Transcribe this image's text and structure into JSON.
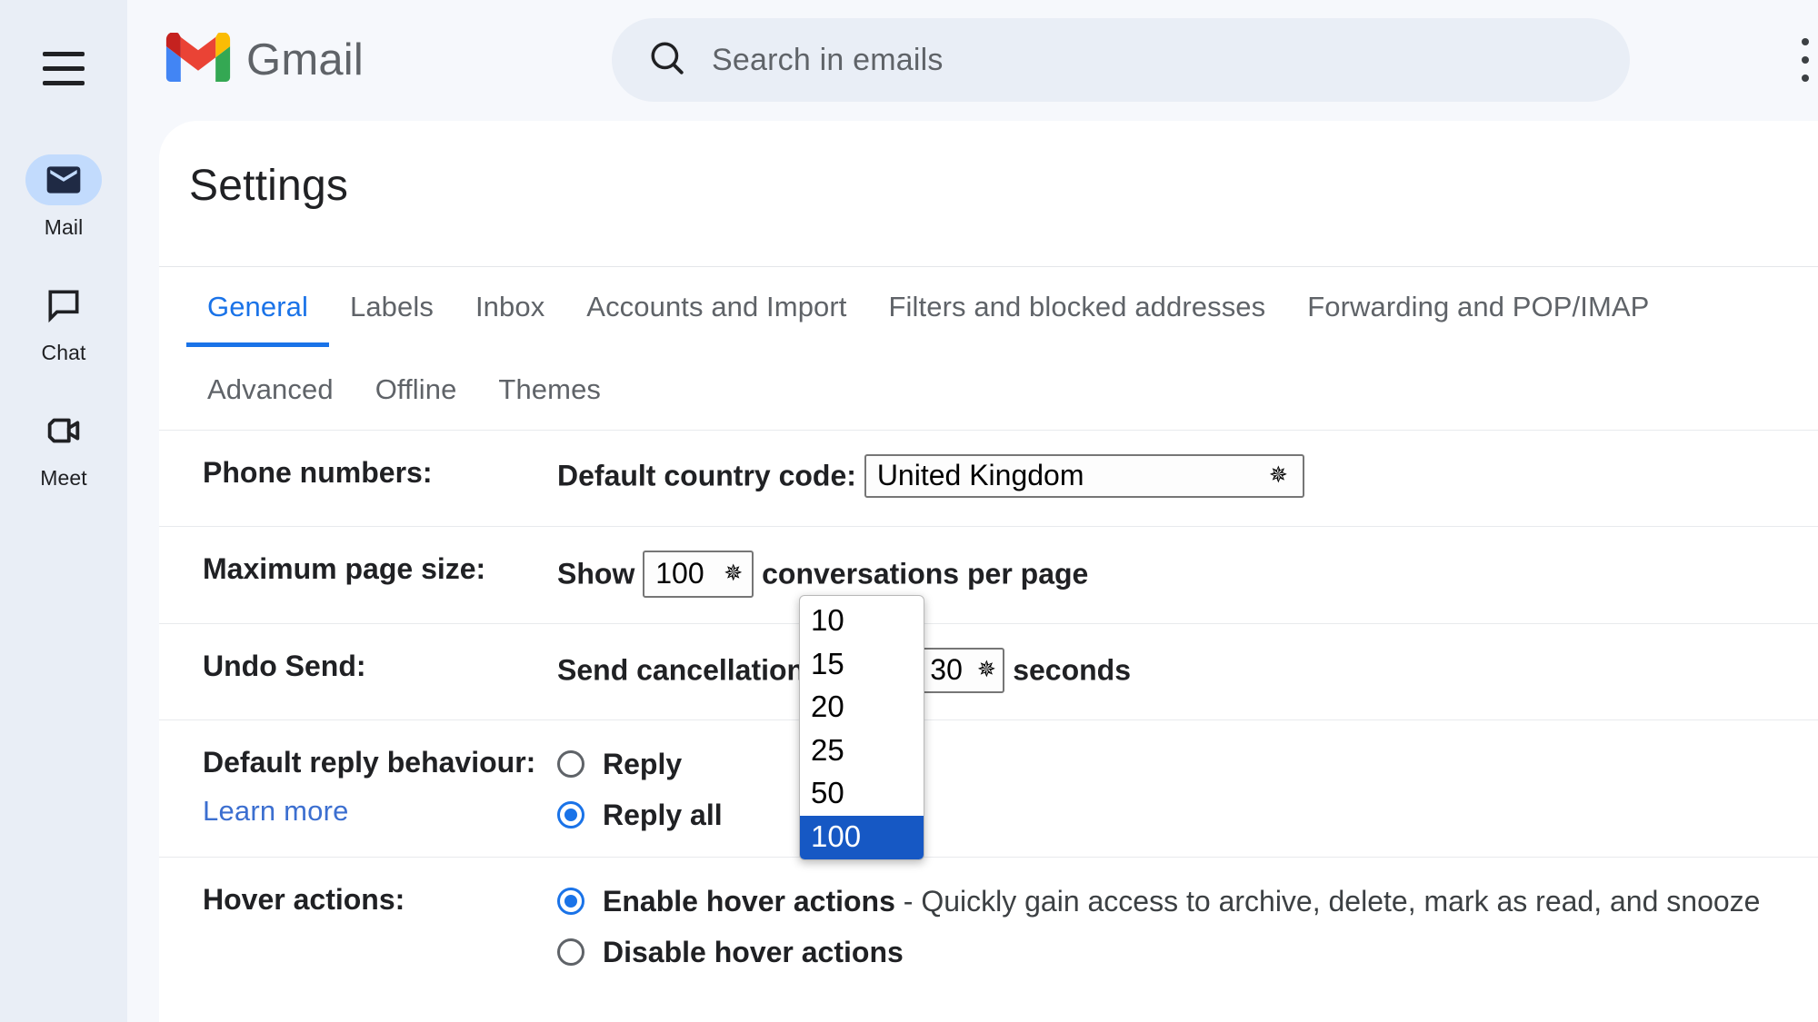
{
  "app": {
    "brand_name": "Gmail",
    "menu_icon": "hamburger-menu-icon",
    "kebab_icon": "more-options-icon"
  },
  "search": {
    "placeholder": "Search in emails",
    "icon": "search-icon"
  },
  "rail": {
    "items": [
      {
        "label": "Mail",
        "icon": "mail-icon",
        "active": true
      },
      {
        "label": "Chat",
        "icon": "chat-bubble-icon",
        "active": false
      },
      {
        "label": "Meet",
        "icon": "video-camera-icon",
        "active": false
      }
    ]
  },
  "page": {
    "title": "Settings"
  },
  "tabs": {
    "row1": [
      {
        "label": "General",
        "active": true
      },
      {
        "label": "Labels",
        "active": false
      },
      {
        "label": "Inbox",
        "active": false
      },
      {
        "label": "Accounts and Import",
        "active": false
      },
      {
        "label": "Filters and blocked addresses",
        "active": false
      },
      {
        "label": "Forwarding and POP/IMAP",
        "active": false
      }
    ],
    "row2": [
      {
        "label": "Advanced",
        "active": false
      },
      {
        "label": "Offline",
        "active": false
      },
      {
        "label": "Themes",
        "active": false
      }
    ]
  },
  "settings": {
    "phone_numbers": {
      "label": "Phone numbers:",
      "prefix": "Default country code:",
      "country_value": "United Kingdom"
    },
    "max_page_size": {
      "label": "Maximum page size:",
      "prefix": "Show",
      "value": "100",
      "suffix": "conversations per page"
    },
    "undo_send": {
      "label": "Undo Send:",
      "prefix": "Send cancellation period:",
      "value": "30",
      "suffix": "seconds"
    },
    "default_reply": {
      "label": "Default reply behaviour:",
      "learn_more": "Learn more",
      "option_1": "Reply",
      "option_1_selected": false,
      "option_2": "Reply all",
      "option_2_selected": true
    },
    "hover_actions": {
      "label": "Hover actions:",
      "option_1": "Enable hover actions",
      "option_1_desc": " - Quickly gain access to archive, delete, mark as read, and snooze",
      "option_1_selected": true,
      "option_2": "Disable hover actions",
      "option_2_selected": false
    }
  },
  "dropdown": {
    "open": true,
    "options": [
      "10",
      "15",
      "20",
      "25",
      "50",
      "100"
    ],
    "selected": "100",
    "highlight_color": "#1658c4"
  },
  "colors": {
    "accent": "#1a73e8",
    "rail_bg": "#e9eef6",
    "panel_bg": "#ffffff",
    "link": "#3c6fd0"
  }
}
